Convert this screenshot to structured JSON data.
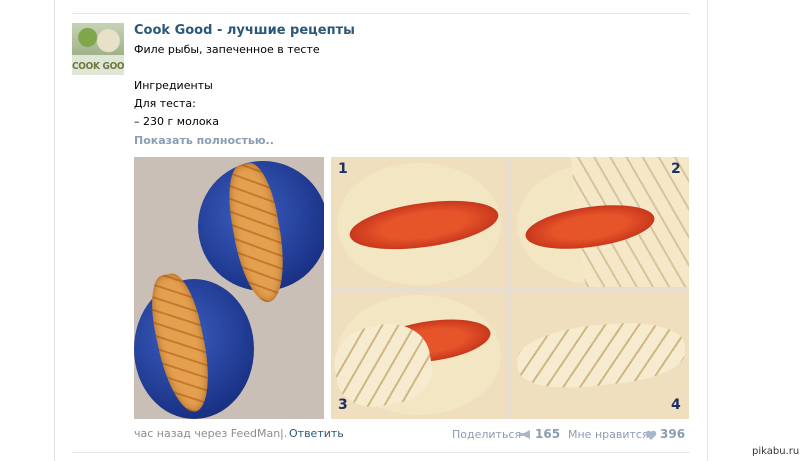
{
  "post": {
    "author": "Cook Good - лучшие рецепты",
    "avatar_text": "COOK GOOD",
    "lines": [
      "Филе рыбы, запеченное в тесте",
      "Ингредиенты",
      "Для теста:",
      "– 230 г молока"
    ],
    "show_more": "Показать полностью.."
  },
  "photos": {
    "steps": [
      "1",
      "2",
      "3",
      "4"
    ]
  },
  "footer": {
    "time": "час назад через FeedMan..",
    "separator": "|",
    "reply": "Ответить",
    "share_label": "Поделиться",
    "share_count": "165",
    "like_label": "Мне нравится",
    "like_count": "396"
  },
  "watermark": "pikabu.ru",
  "colors": {
    "link": "#2b587a",
    "muted": "#8a9db2",
    "plate_blue": "#1b3488"
  }
}
